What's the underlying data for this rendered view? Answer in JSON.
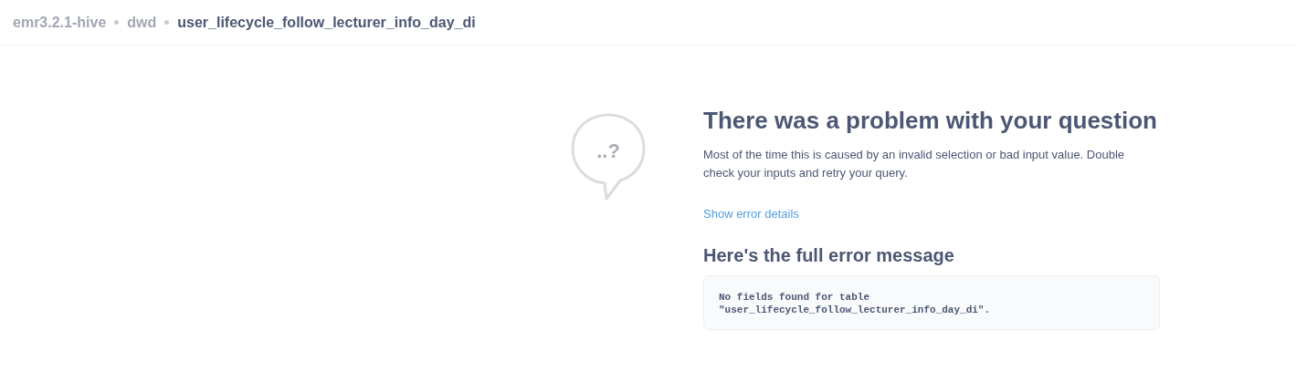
{
  "breadcrumb": [
    {
      "label": "emr3.2.1-hive",
      "selected": false
    },
    {
      "label": "dwd",
      "selected": false
    },
    {
      "label": "user_lifecycle_follow_lecturer_info_day_di",
      "selected": true
    }
  ],
  "error": {
    "icon_text": "..?",
    "title": "There was a problem with your question",
    "description": "Most of the time this is caused by an invalid selection or bad input value. Double check your inputs and retry your query.",
    "details_link": "Show error details",
    "message_heading": "Here's the full error message",
    "message": "No fields found for table \"user_lifecycle_follow_lecturer_info_day_di\"."
  }
}
